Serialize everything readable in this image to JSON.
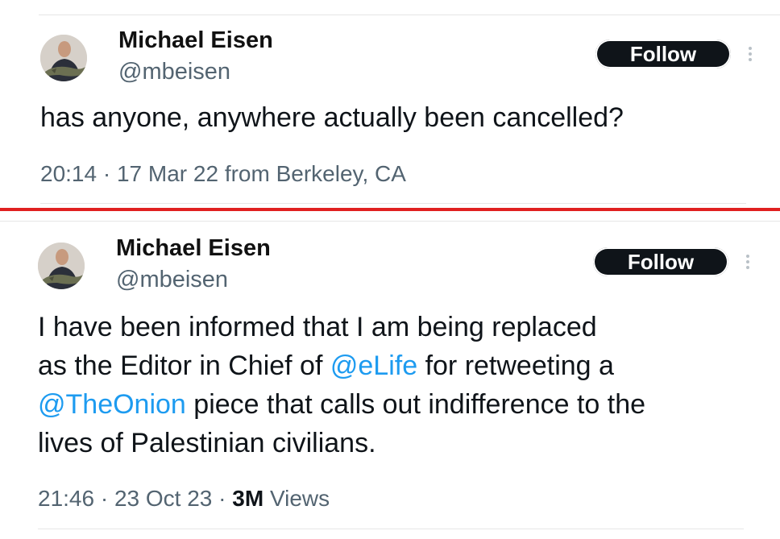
{
  "tweets": [
    {
      "name": "Michael Eisen",
      "handle": "@mbeisen",
      "follow_label": "Follow",
      "text_parts": [
        "has anyone, anywhere actually been cancelled?"
      ],
      "time": "20:14",
      "date": "17 Mar 22",
      "location": "from Berkeley, CA"
    },
    {
      "name": "Michael Eisen",
      "handle": "@mbeisen",
      "follow_label": "Follow",
      "line1": "I have been informed that I am being replaced",
      "line2_pre": "as the Editor in Chief of ",
      "mention1": "@eLife",
      "line2_post": " for retweeting a",
      "mention2": "@TheOnion",
      "line3_post": " piece that calls out indifference to the",
      "line4": "lives of Palestinian civilians.",
      "time": "21:46",
      "date": "23 Oct 23",
      "views_count": "3M",
      "views_label": "Views"
    }
  ],
  "separator_dot": "·",
  "colors": {
    "accent": "#1d9bf0",
    "divider": "#e02020",
    "button": "#0f1419"
  },
  "icons": [
    "avatar",
    "more-options-icon"
  ]
}
